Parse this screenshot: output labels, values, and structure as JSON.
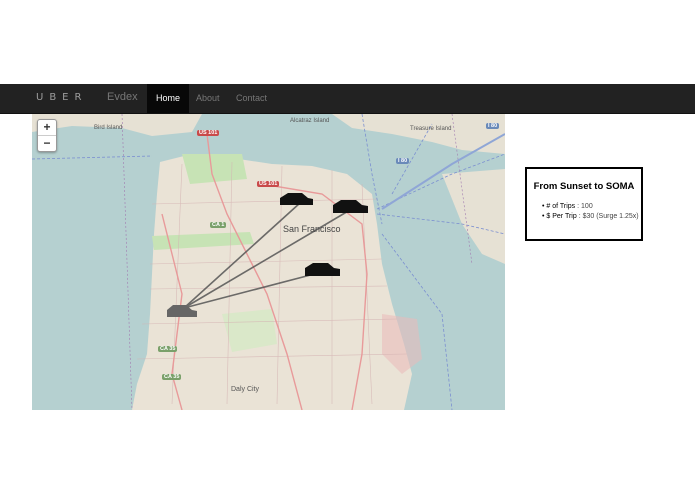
{
  "navbar": {
    "logo": "UBER",
    "brand": "Evdex",
    "items": [
      {
        "label": "Home",
        "active": true
      },
      {
        "label": "About",
        "active": false
      },
      {
        "label": "Contact",
        "active": false
      }
    ]
  },
  "map": {
    "zoom_in": "+",
    "zoom_out": "−",
    "city": "San Francisco",
    "labels": {
      "bird_island": "Bird Island",
      "alcatraz": "Alcatraz Island",
      "treasure": "Treasure Island",
      "daly_city": "Daly City"
    },
    "shields": {
      "us101_ca1": "US 101\nCA 1",
      "us101": "US 101",
      "i80_top": "I 80",
      "i80": "I 80",
      "ca1": "CA 1",
      "ca35": "CA 35",
      "ca35b": "CA 35"
    },
    "colors": {
      "water": "#b5d0d0",
      "land": "#eae3d6",
      "park": "#c7e3b5",
      "route_line": "#555555"
    }
  },
  "info_box": {
    "title": "From Sunset to SOMA",
    "trips_label": "• # of Trips",
    "trips_value": ": 100",
    "price_label": "• $ Per Trip",
    "price_value": ": $30 (Surge 1.25x)"
  }
}
